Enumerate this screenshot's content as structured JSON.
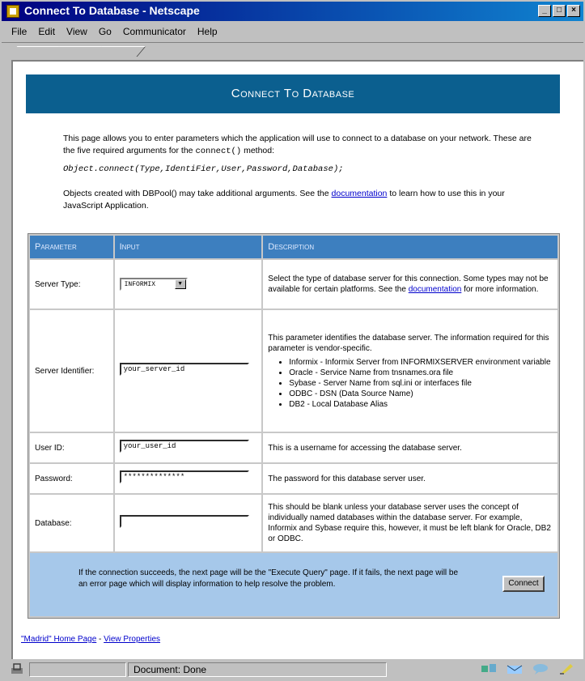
{
  "window": {
    "title": "Connect To Database - Netscape",
    "buttons": [
      "_",
      "□",
      "×"
    ]
  },
  "menu": [
    "File",
    "Edit",
    "View",
    "Go",
    "Communicator",
    "Help"
  ],
  "banner": "Connect To Database",
  "intro": {
    "p1": "This page allows you to enter parameters which the application will use to connect to a database on your network. These are the five required arguments for the",
    "p1_code": "connect()",
    "p1_end": "method:",
    "signature": "Object.connect(Type,IdentiFier,User,Password,Database);",
    "p3_start": "Objects created with DBPool() may take additional arguments. See the",
    "p3_link": "documentation",
    "p3_end": "to learn how to use this in your JavaScript Application."
  },
  "table": {
    "headers": [
      "Parameter",
      "Input",
      "Description"
    ],
    "rows": [
      {
        "label": "Server Type:",
        "select": "INFORMIX",
        "desc": "Select the type of database server for this connection. Some types may not be available for certain platforms. See the",
        "desc_link": "documentation",
        "desc_end": "for more information."
      },
      {
        "label": "Server Identifier:",
        "value": "your_server_id",
        "desc": "This parameter identifies the database server. The information required for this parameter is vendor-specific.",
        "vendors": [
          "Informix - Informix Server from INFORMIXSERVER environment variable",
          "Oracle - Service Name from tnsnames.ora file",
          "Sybase - Server Name from sql.ini or interfaces file",
          "ODBC - DSN (Data Source Name)",
          "DB2 - Local Database Alias"
        ]
      },
      {
        "label": "User ID:",
        "value": "your_user_id",
        "desc": "This is a username for accessing the database server."
      },
      {
        "label": "Password:",
        "value": "**************",
        "desc": "The password for this database server user."
      },
      {
        "label": "Database:",
        "value": "",
        "desc": "This should be blank unless your database server uses the concept of individually named databases within the database server. For example, Informix and Sybase require this, however, it must be left blank for Oracle, DB2 or ODBC."
      }
    ],
    "footer_text": "If the connection succeeds, the next page will be the \"Execute Query\" page. If it fails, the next page will be an error page which will display information to help resolve the problem.",
    "connect_button": "Connect"
  },
  "links": {
    "home": "\"Madrid\" Home Page",
    "sep": " - ",
    "props": "View Properties"
  },
  "status": {
    "text": "Document: Done"
  }
}
